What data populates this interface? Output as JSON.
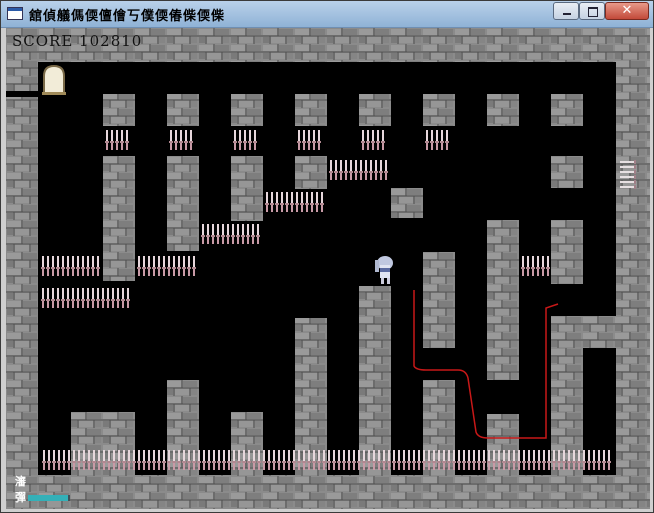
{
  "window": {
    "title": "舘偵艤傌偄儃儈丂僕偄偆偨偄偨",
    "close_glyph": "✕"
  },
  "hud": {
    "score_text": "SCORE 102810",
    "label_top": "瀋",
    "label_bottom": "彈",
    "gauge_fraction": 0.95,
    "gauge_color": "#34b0b8"
  },
  "colors": {
    "stone": "#8a8a8a",
    "background": "#000000",
    "trail": "#c81818",
    "door": "#f2ecd8",
    "spike": "#d8b8c0"
  },
  "icons": {
    "player": "silver-haired-maid-sprite",
    "door": "arched-door-icon",
    "hazard": "knife-spike-icon"
  }
}
